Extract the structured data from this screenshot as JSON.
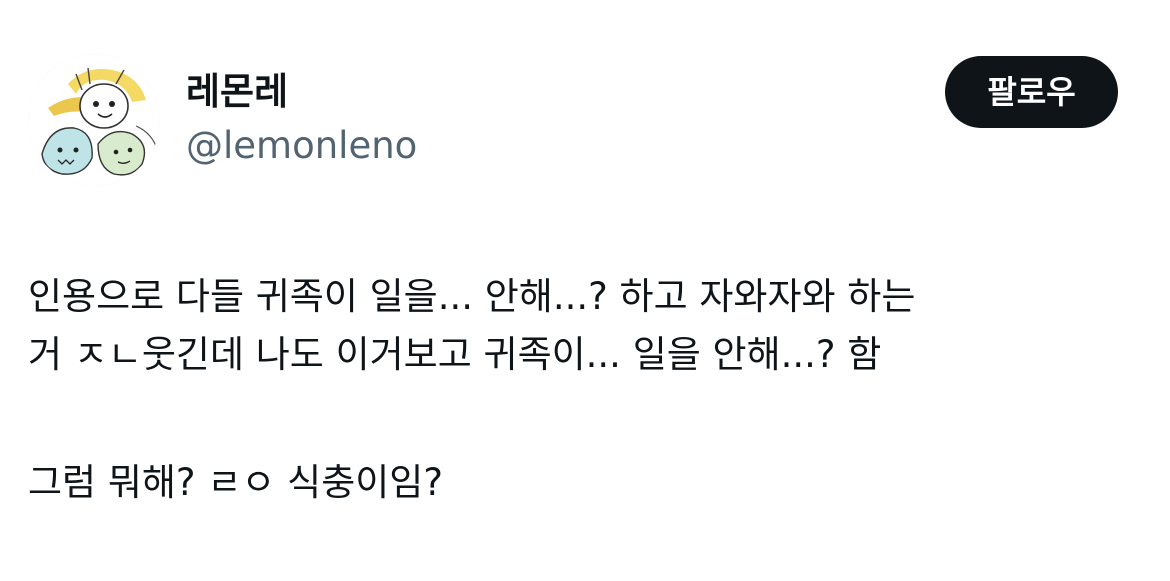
{
  "author": {
    "name": "레몬레",
    "handle": "@lemonleno",
    "avatar_icon": "cartoon-avatar-icon"
  },
  "follow_button": {
    "label": "팔로우"
  },
  "tweet": {
    "lines": [
      "인용으로 다들 귀족이 일을... 안해...? 하고 자와자와 하는",
      "거 ㅈㄴ웃긴데 나도 이거보고 귀족이... 일을 안해...? 함",
      "",
      "그럼 뭐해? ㄹㅇ 식충이임?"
    ]
  },
  "colors": {
    "text": "#0f1419",
    "secondary_text": "#536471",
    "button_bg": "#0f1419",
    "button_text": "#ffffff"
  }
}
